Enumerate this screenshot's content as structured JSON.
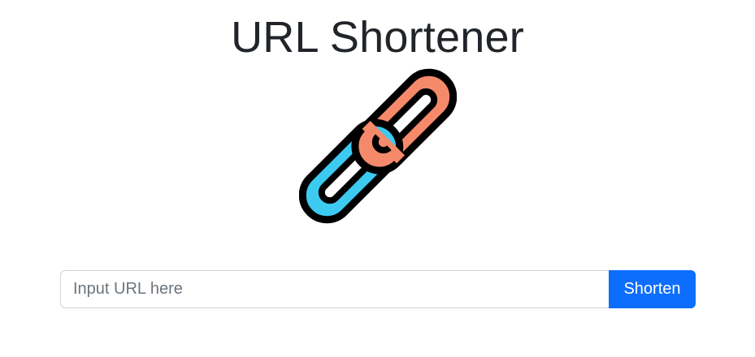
{
  "header": {
    "title": "URL Shortener"
  },
  "logo": {
    "icon": "chain-link-icon",
    "colors": {
      "link_orange": "#f58a6b",
      "link_blue": "#3dcaf1",
      "outline": "#000000"
    }
  },
  "form": {
    "input_placeholder": "Input URL here",
    "input_value": "",
    "button_label": "Shorten"
  },
  "theme": {
    "primary": "#0d6efd",
    "text": "#212529",
    "placeholder": "#6c757d",
    "border": "#ced4da"
  }
}
